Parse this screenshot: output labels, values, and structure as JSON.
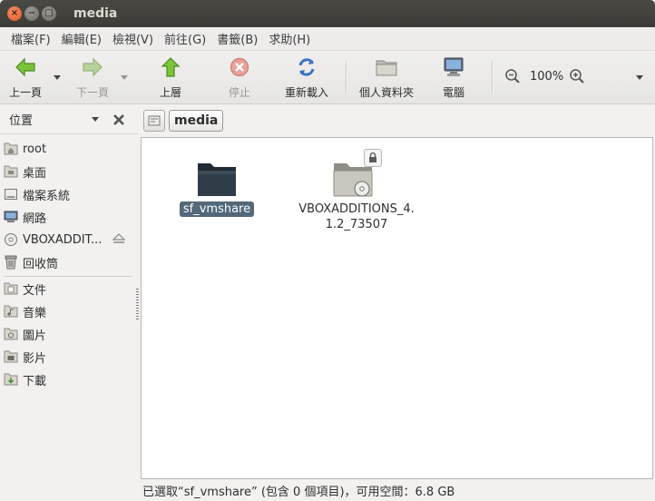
{
  "window": {
    "title": "media"
  },
  "menu": [
    {
      "label": "檔案(F)"
    },
    {
      "label": "編輯(E)"
    },
    {
      "label": "檢視(V)"
    },
    {
      "label": "前往(G)"
    },
    {
      "label": "書籤(B)"
    },
    {
      "label": "求助(H)"
    }
  ],
  "toolbar": {
    "back": "上一頁",
    "forward": "下一頁",
    "up": "上層",
    "stop": "停止",
    "reload": "重新載入",
    "home": "個人資料夾",
    "computer": "電腦",
    "zoom": "100%"
  },
  "sidebar": {
    "header": "位置",
    "places": [
      {
        "label": "root",
        "icon": "home-folder-icon"
      },
      {
        "label": "桌面",
        "icon": "desktop-folder-icon"
      },
      {
        "label": "檔案系統",
        "icon": "filesystem-icon"
      },
      {
        "label": "網路",
        "icon": "network-icon"
      },
      {
        "label": "VBOXADDIT...",
        "icon": "cdrom-icon"
      },
      {
        "label": "回收筒",
        "icon": "trash-icon"
      }
    ],
    "bookmarks": [
      {
        "label": "文件",
        "icon": "documents-folder-icon"
      },
      {
        "label": "音樂",
        "icon": "music-folder-icon"
      },
      {
        "label": "圖片",
        "icon": "pictures-folder-icon"
      },
      {
        "label": "影片",
        "icon": "videos-folder-icon"
      },
      {
        "label": "下載",
        "icon": "downloads-folder-icon"
      }
    ]
  },
  "pathbar": {
    "current": "media"
  },
  "files": [
    {
      "name": "sf_vmshare",
      "selected": true
    },
    {
      "name": "VBOXADDITIONS_4.\n1.2_73507",
      "selected": false
    }
  ],
  "status": {
    "text": "已選取“sf_vmshare” (包含 0 個項目)，可用空間：6.8 GB"
  },
  "colors": {
    "accent": "#53687a",
    "close_button": "#e0561d",
    "titlebar": "#3c3b37"
  }
}
